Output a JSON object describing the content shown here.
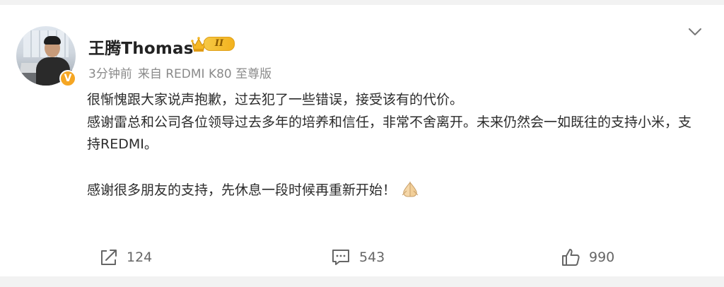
{
  "post": {
    "user": {
      "name": "王腾Thomas",
      "verified_badge": "V",
      "level_tag": "II"
    },
    "meta": {
      "time": "3分钟前",
      "source": "来自 REDMI K80 至尊版"
    },
    "content": {
      "line1": "很惭愧跟大家说声抱歉，过去犯了一些错误，接受该有的代价。",
      "line2": "感谢雷总和公司各位领导过去多年的培养和信任，非常不舍离开。未来仍然会一如既往的支持小米，支持REDMI。",
      "line3": "感谢很多朋友的支持，先休息一段时候再重新开始！",
      "emoji": "folded-hands-icon"
    },
    "actions": {
      "repost_count": "124",
      "comment_count": "543",
      "like_count": "990"
    }
  },
  "colors": {
    "background": "#f2f2f2",
    "card": "#ffffff",
    "text": "#2b2b2b",
    "meta": "#8a8a8a",
    "badge_orange": "#f5a623"
  }
}
